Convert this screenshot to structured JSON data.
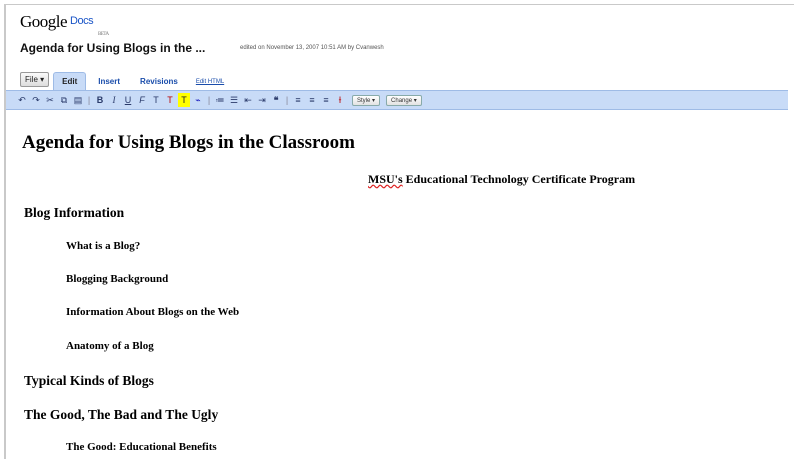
{
  "app": {
    "logo_google": "Google",
    "logo_docs": "Docs",
    "logo_beta": "BETA"
  },
  "document": {
    "title": "Agenda for Using Blogs in the ...",
    "edited_info": "edited on November 13, 2007 10:51 AM by Cvanwesh"
  },
  "menu": {
    "file": "File ▾",
    "tabs": [
      "Edit",
      "Insert",
      "Revisions"
    ],
    "edit_html": "Edit HTML"
  },
  "toolbar": {
    "icons": [
      "undo-icon",
      "redo-icon",
      "cut-icon",
      "copy-icon",
      "paste-icon",
      "bold-icon",
      "italic-icon",
      "underline-icon",
      "font-icon",
      "font-size-icon",
      "text-color-icon",
      "highlight-icon",
      "link-icon",
      "numbered-list-icon",
      "bulleted-list-icon",
      "outdent-icon",
      "indent-icon",
      "quote-icon",
      "align-left-icon",
      "align-center-icon",
      "align-right-icon",
      "clear-format-icon"
    ],
    "style_dropdown": "Style ▾",
    "change_dropdown": "Change ▾"
  },
  "content": {
    "heading": "Agenda for Using Blogs in the Classroom",
    "subtitle_pre": "MSU's",
    "subtitle_post": " Educational Technology Certificate Program",
    "sections": [
      {
        "level": 2,
        "text": "Blog Information"
      },
      {
        "level": 3,
        "text": "What is a Blog?"
      },
      {
        "level": 3,
        "text": "Blogging Background"
      },
      {
        "level": 3,
        "text": "Information About Blogs on the Web"
      },
      {
        "level": 3,
        "text": "Anatomy of a Blog"
      },
      {
        "level": 2,
        "text": "Typical Kinds of Blogs"
      },
      {
        "level": 2,
        "text": "The Good, The Bad and The Ugly"
      },
      {
        "level": 3,
        "text": "The Good: Educational Benefits"
      }
    ]
  }
}
